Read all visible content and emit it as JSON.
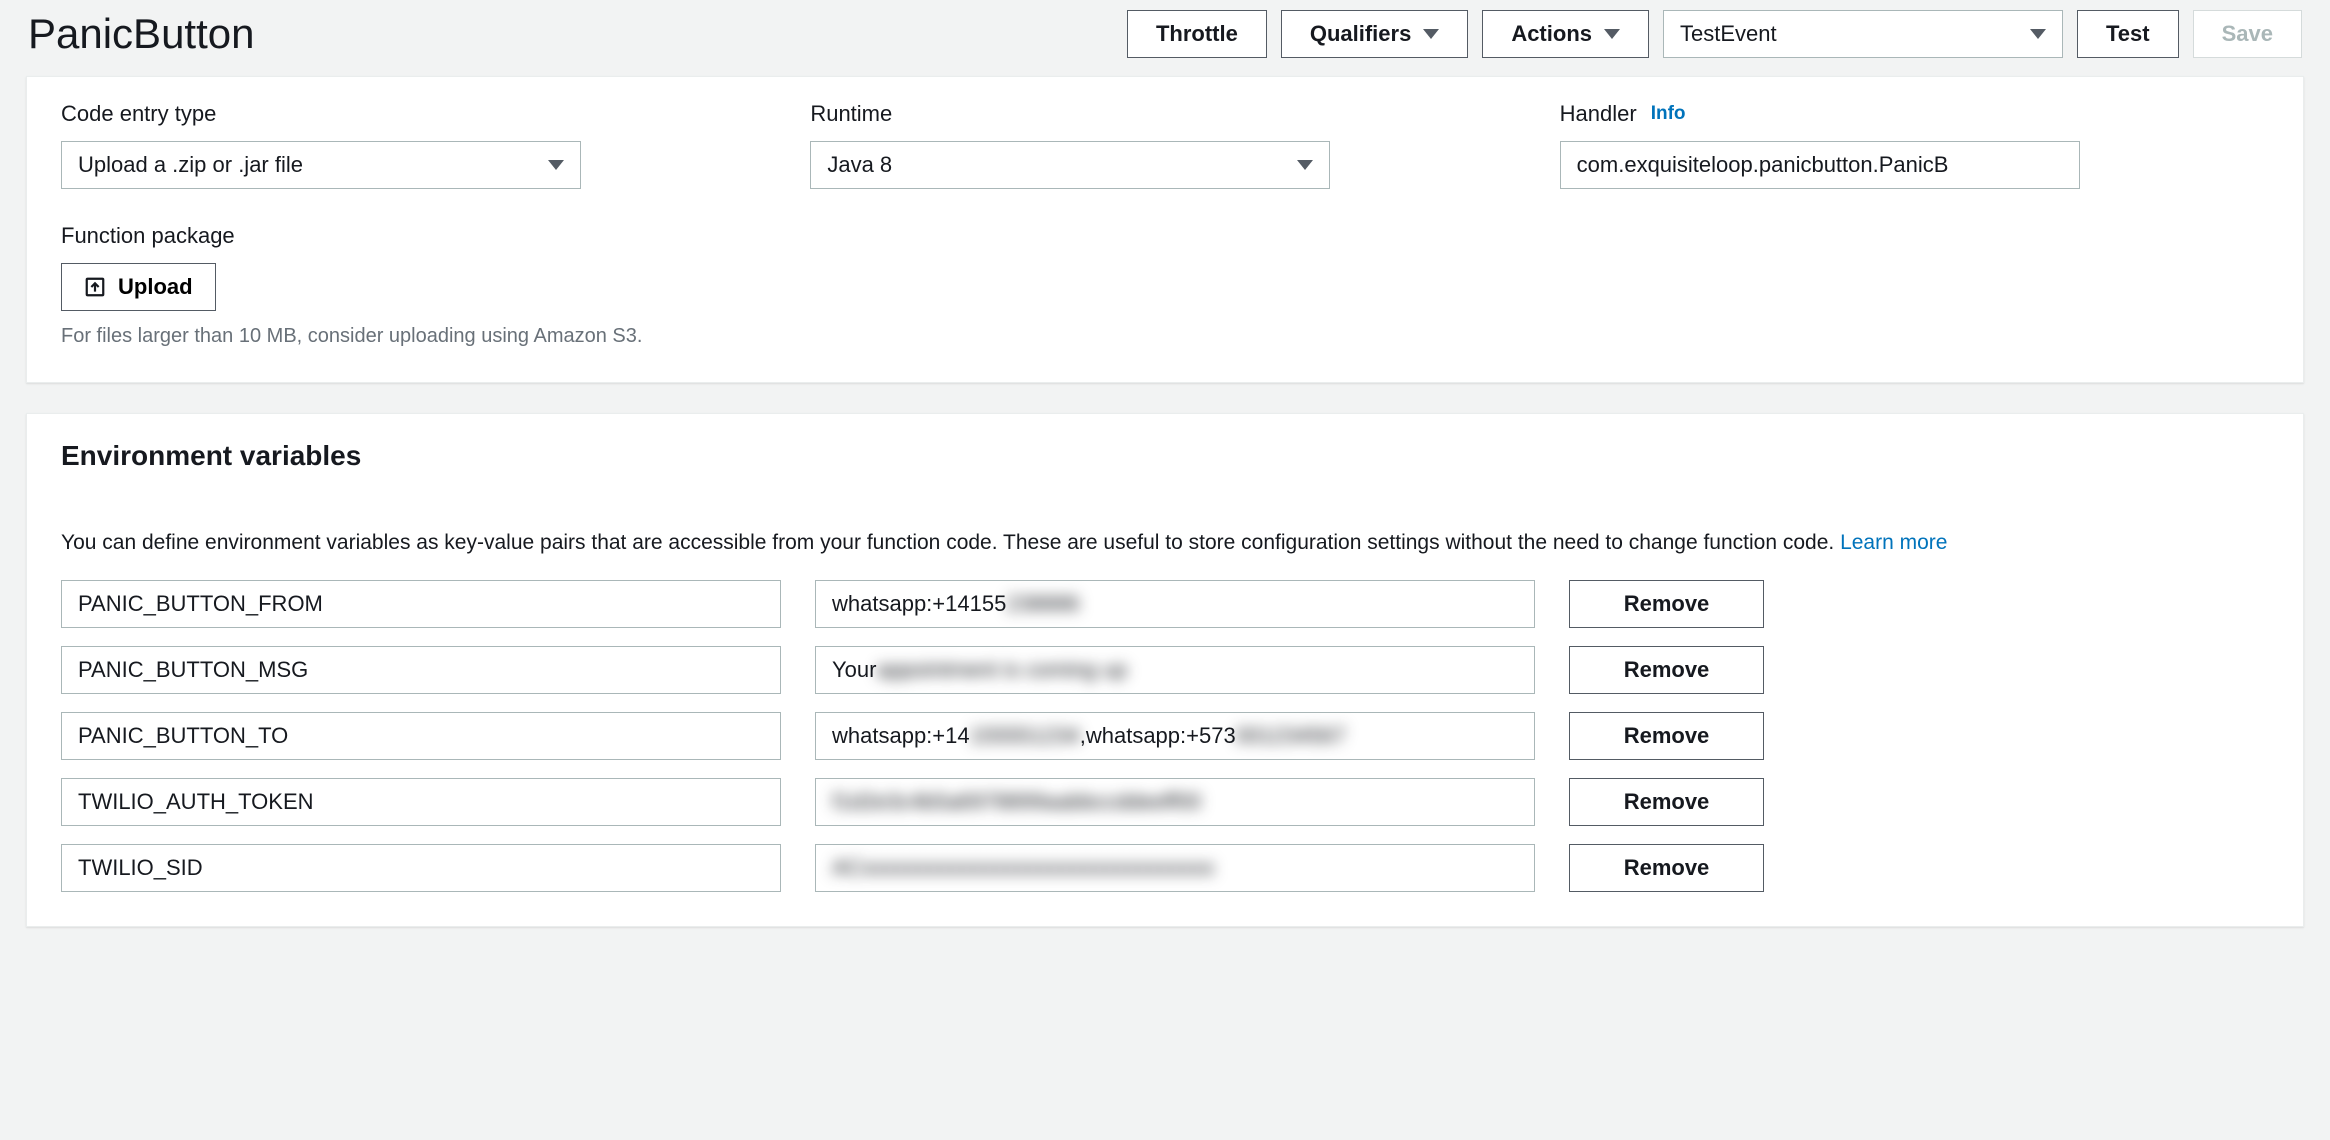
{
  "header": {
    "title": "PanicButton",
    "throttle": "Throttle",
    "qualifiers": "Qualifiers",
    "actions": "Actions",
    "test_event": "TestEvent",
    "test": "Test",
    "save": "Save"
  },
  "code": {
    "entry_type_label": "Code entry type",
    "entry_type_value": "Upload a .zip or .jar file",
    "runtime_label": "Runtime",
    "runtime_value": "Java 8",
    "handler_label": "Handler",
    "handler_info": "Info",
    "handler_value": "com.exquisiteloop.panicbutton.PanicB",
    "package_label": "Function package",
    "upload": "Upload",
    "upload_hint": "For files larger than 10 MB, consider uploading using Amazon S3."
  },
  "env": {
    "title": "Environment variables",
    "description": "You can define environment variables as key-value pairs that are accessible from your function code. These are useful to store configuration settings without the need to change function code. ",
    "learn_more": "Learn more",
    "remove_label": "Remove",
    "vars": [
      {
        "key": "PANIC_BUTTON_FROM",
        "value_prefix": "whatsapp:+14155",
        "value_blurred": "238886"
      },
      {
        "key": "PANIC_BUTTON_MSG",
        "value_prefix": "Your ",
        "value_blurred": "appointment is coming up"
      },
      {
        "key": "PANIC_BUTTON_TO",
        "value_prefix": "whatsapp:+14",
        "value_mid_blurred": "155551234",
        "value_mid": ",whatsapp:+573",
        "value_blurred": "001234567"
      },
      {
        "key": "TWILIO_AUTH_TOKEN",
        "value_prefix": "",
        "value_blurred": "f1d2e3c4b5a6978899aabbccddeeff00"
      },
      {
        "key": "TWILIO_SID",
        "value_prefix": "",
        "value_blurred": "ACxxxxxxxxxxxxxxxxxxxxxxxxxxxxxxxx"
      }
    ]
  }
}
